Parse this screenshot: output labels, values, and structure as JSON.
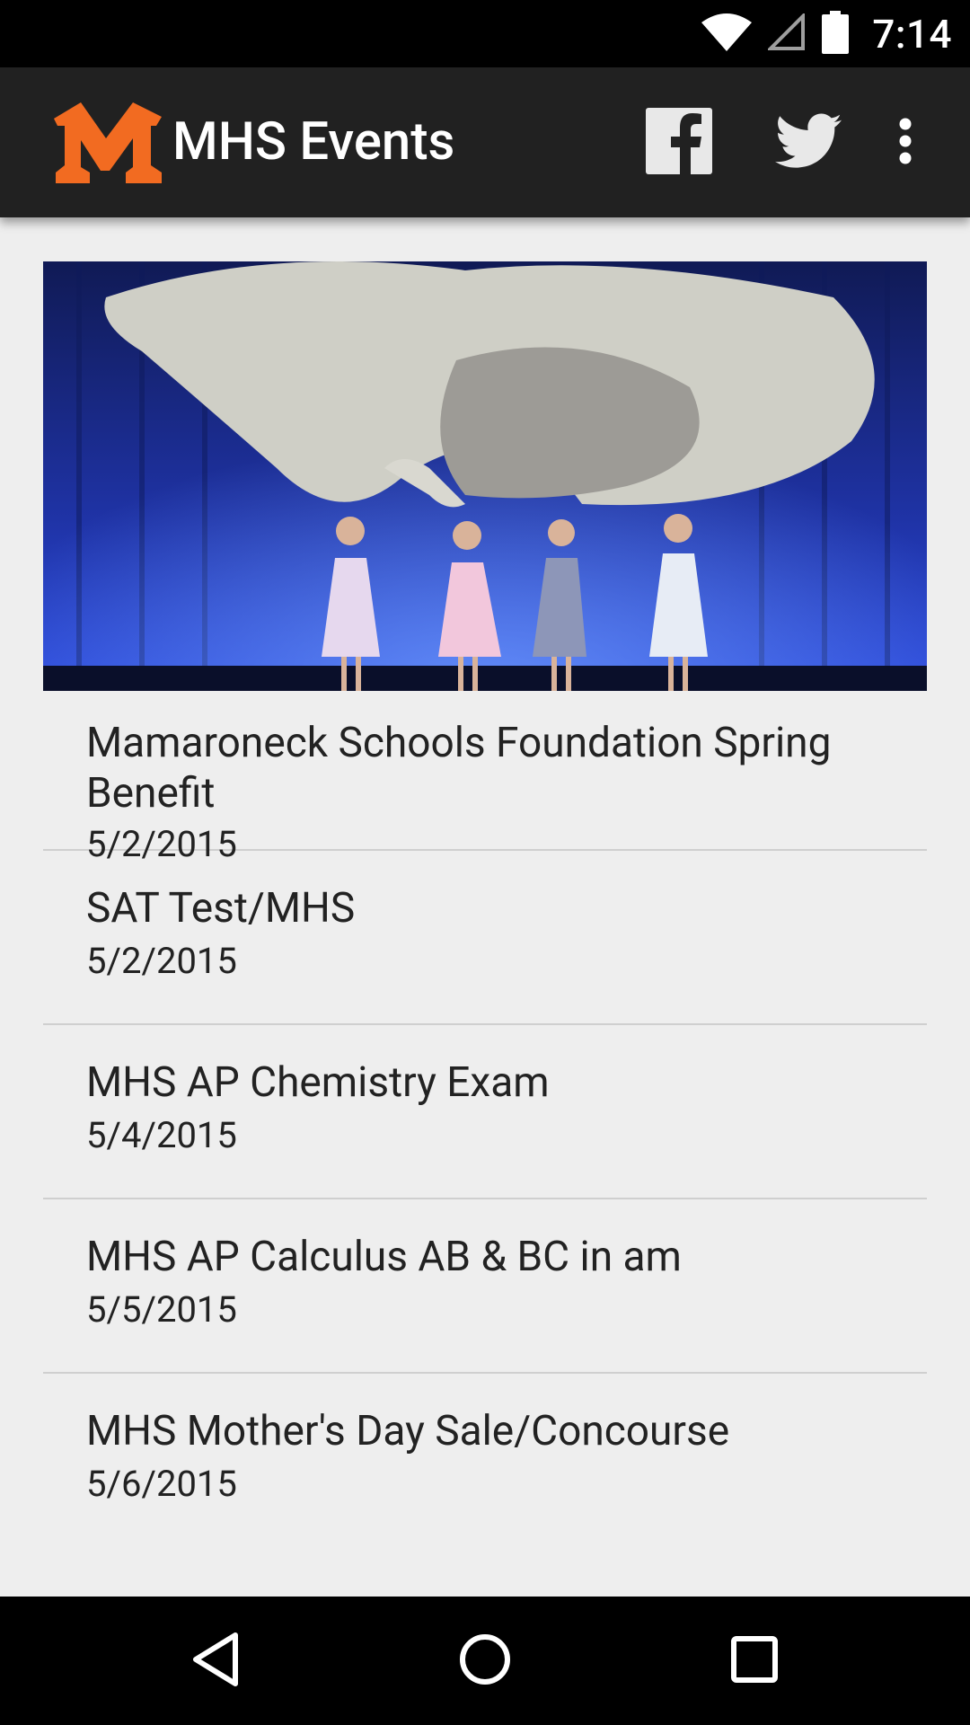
{
  "status_bar": {
    "time": "7:14",
    "icons": [
      "wifi-icon",
      "cell-signal-icon",
      "battery-icon"
    ]
  },
  "app_bar": {
    "logo_letter": "M",
    "title": "MHS Events",
    "actions": [
      "facebook-icon",
      "twitter-icon",
      "more-vert-icon"
    ],
    "colors": {
      "bar": "#212121",
      "logo": "#f26b21"
    }
  },
  "hero_image": {
    "description_icon": "dance-performance-photo"
  },
  "events": [
    {
      "title": "Mamaroneck Schools Foundation Spring Benefit",
      "date": "5/2/2015"
    },
    {
      "title": "SAT Test/MHS",
      "date": "5/2/2015"
    },
    {
      "title": "MHS AP Chemistry Exam",
      "date": "5/4/2015"
    },
    {
      "title": "MHS AP Calculus AB & BC in am",
      "date": "5/5/2015"
    },
    {
      "title": "MHS Mother's Day Sale/Concourse",
      "date": "5/6/2015"
    }
  ],
  "nav_bar": {
    "buttons": [
      "back-icon",
      "home-icon",
      "recents-icon"
    ]
  }
}
